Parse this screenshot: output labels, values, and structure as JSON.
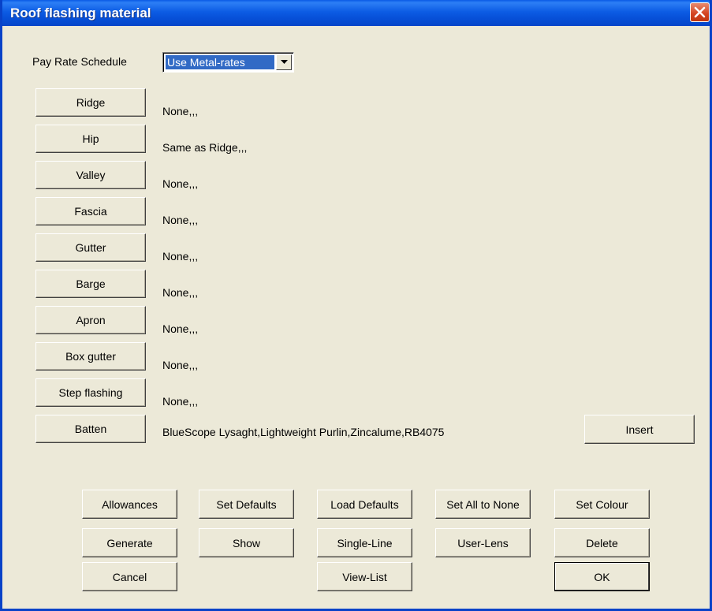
{
  "window": {
    "title": "Roof flashing material"
  },
  "pay_rate": {
    "label": "Pay Rate Schedule",
    "selected": "Use Metal-rates"
  },
  "flashings": [
    {
      "button": "Ridge",
      "value": "None,,,"
    },
    {
      "button": "Hip",
      "value": "Same as Ridge,,,"
    },
    {
      "button": "Valley",
      "value": "None,,,"
    },
    {
      "button": "Fascia",
      "value": "None,,,"
    },
    {
      "button": "Gutter",
      "value": "None,,,"
    },
    {
      "button": "Barge",
      "value": "None,,,"
    },
    {
      "button": "Apron",
      "value": "None,,,"
    },
    {
      "button": "Box gutter",
      "value": "None,,,"
    },
    {
      "button": "Step flashing",
      "value": "None,,,"
    },
    {
      "button": "Batten",
      "value": "BlueScope Lysaght,Lightweight Purlin,Zincalume,RB4075"
    }
  ],
  "buttons": {
    "insert": "Insert",
    "allowances": "Allowances",
    "set_defaults": "Set Defaults",
    "load_defaults": "Load Defaults",
    "set_all_none": "Set All to None",
    "set_colour": "Set Colour",
    "generate": "Generate",
    "show": "Show",
    "single_line": "Single-Line",
    "user_lens": "User-Lens",
    "delete": "Delete",
    "cancel": "Cancel",
    "view_list": "View-List",
    "ok": "OK"
  },
  "icons": {
    "close": "close-icon",
    "dropdown": "chevron-down-icon"
  },
  "colors": {
    "titlebar": "#0a5ae6",
    "selection": "#316ac5",
    "dialog_bg": "#ece9d8",
    "close": "#d3431f"
  }
}
